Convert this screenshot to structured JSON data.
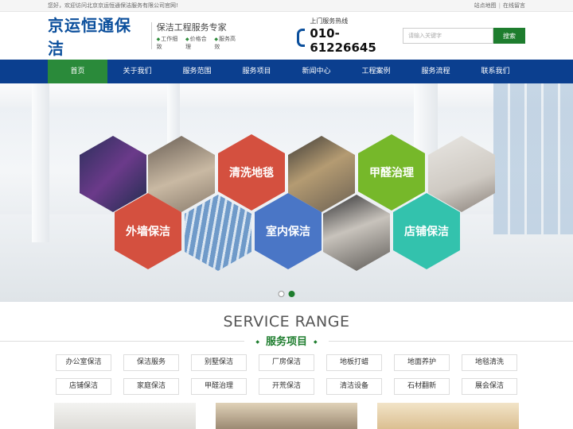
{
  "topbar": {
    "welcome": "您好，欢迎访问北京京运恒通保洁服务有限公司官网!",
    "sitemap": "站点地图",
    "separator": "|",
    "message": "在线留言"
  },
  "header": {
    "logo": "京运恒通保洁",
    "slogan": "保洁工程服务专家",
    "slogan_tags": [
      "工作细致",
      "价格合理",
      "服务高效"
    ],
    "hotline_label": "上门服务热线",
    "hotline_number": "010-61226645",
    "search_placeholder": "请输入关键字",
    "search_button": "搜索"
  },
  "nav": {
    "items": [
      "首页",
      "关于我们",
      "服务范围",
      "服务项目",
      "新闻中心",
      "工程案例",
      "服务流程",
      "联系我们"
    ],
    "active_index": 0
  },
  "banner": {
    "hex_labels": [
      "清洗地毯",
      "甲醛治理",
      "外墙保洁",
      "室内保洁",
      "店铺保洁"
    ],
    "slide_count": 2,
    "active_slide": 2
  },
  "service": {
    "title_en": "SERVICE RANGE",
    "title_cn": "服务项目",
    "tags": [
      "办公室保洁",
      "保洁服务",
      "别墅保洁",
      "厂房保洁",
      "地板打蜡",
      "地面养护",
      "地毯清洗",
      "店铺保洁",
      "家庭保洁",
      "甲醛治理",
      "开荒保洁",
      "清洁设备",
      "石材翻新",
      "展会保洁"
    ]
  },
  "colors": {
    "brand_blue": "#0b3f8f",
    "brand_green": "#1e7d2e",
    "hex_red": "#d4503f",
    "hex_green": "#76b82a",
    "hex_blue": "#4a76c6",
    "hex_teal": "#33c2ad"
  }
}
